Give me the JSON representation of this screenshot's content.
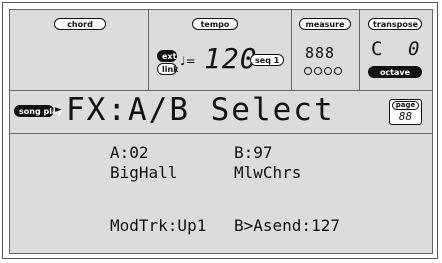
{
  "header": {
    "chord_label": "chord",
    "tempo_label": "tempo",
    "ext_label": "ext",
    "link_label": "link",
    "note_symbol": "♩=",
    "tempo_value": "120",
    "seq_label": "seq 1",
    "measure_label": "measure",
    "measure_value": "888",
    "transpose_label": "transpose",
    "transpose_letter": "C",
    "transpose_value": "0",
    "octave_label": "octave"
  },
  "page": {
    "mode_label": "song play",
    "title": "FX:A/B Select",
    "page_label": "page",
    "page_value": "88"
  },
  "body": {
    "a_label": "A:02",
    "b_label": "B:97",
    "a_name": "BigHall",
    "b_name": "MlwChrs",
    "modtrk": "ModTrk:Up1",
    "bsend": "B>Asend:127"
  }
}
